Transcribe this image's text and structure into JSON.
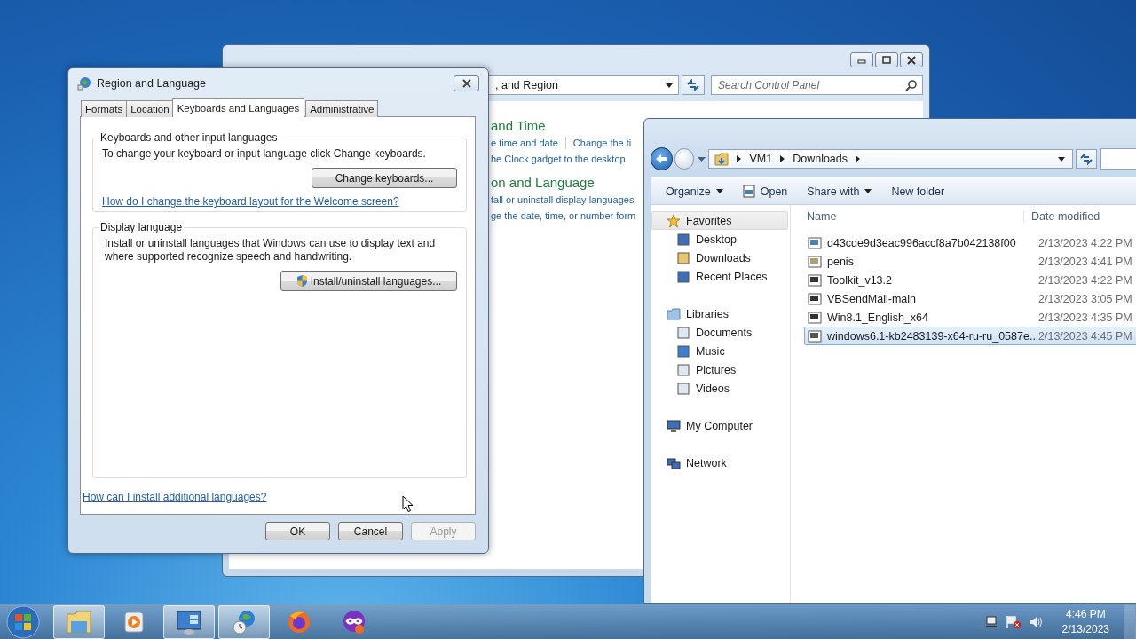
{
  "control_panel": {
    "address": ", and Region",
    "search_placeholder": "Search Control Panel",
    "sections": [
      {
        "heading": "and Time",
        "link_rows": [
          [
            "e time and date",
            "Change the ti"
          ],
          [
            "he Clock gadget to the desktop"
          ]
        ]
      },
      {
        "heading": "on and Language",
        "link_rows": [
          [
            "tall or uninstall display languages"
          ],
          [
            "ge the date, time, or number form"
          ]
        ]
      }
    ]
  },
  "region_dialog": {
    "title": "Region and Language",
    "tabs": [
      {
        "label": "Formats",
        "selected": false
      },
      {
        "label": "Location",
        "selected": false
      },
      {
        "label": "Keyboards and Languages",
        "selected": true
      },
      {
        "label": "Administrative",
        "selected": false
      }
    ],
    "groups": [
      {
        "legend": "Keyboards and other input languages",
        "text": "To change your keyboard or input language click Change keyboards.",
        "button": {
          "label": "Change keyboards...",
          "shield": false
        },
        "link": "How do I change the keyboard layout for the Welcome screen?"
      },
      {
        "legend": "Display language",
        "text": "Install or uninstall languages that Windows can use to display text and where supported recognize speech and handwriting.",
        "button": {
          "label": "Install/uninstall languages...",
          "shield": true
        }
      }
    ],
    "footer_link": "How can I install additional languages?",
    "buttons": [
      {
        "label": "OK",
        "disabled": false
      },
      {
        "label": "Cancel",
        "disabled": false
      },
      {
        "label": "Apply",
        "disabled": true
      }
    ]
  },
  "explorer": {
    "breadcrumb": [
      "VM1",
      "Downloads"
    ],
    "toolbar": [
      {
        "label": "Organize",
        "kind": "menu"
      },
      {
        "label": "Open",
        "kind": "icon"
      },
      {
        "label": "Share with",
        "kind": "menu"
      },
      {
        "label": "New folder",
        "kind": "plain"
      }
    ],
    "nav": [
      {
        "label": "Favorites",
        "selected": true,
        "children": [
          {
            "label": "Desktop",
            "selected": false
          },
          {
            "label": "Downloads",
            "selected": false
          },
          {
            "label": "Recent Places",
            "selected": false
          }
        ]
      },
      {
        "label": "Libraries",
        "selected": false,
        "children": [
          {
            "label": "Documents",
            "selected": false
          },
          {
            "label": "Music",
            "selected": false
          },
          {
            "label": "Pictures",
            "selected": false
          },
          {
            "label": "Videos",
            "selected": false
          }
        ]
      },
      {
        "label": "My Computer",
        "selected": false
      },
      {
        "label": "Network",
        "selected": false
      }
    ],
    "columns": [
      "Name",
      "Date modified"
    ],
    "files": [
      {
        "name": "d43cde9d3eac996accf8a7b042138f00",
        "date": "2/13/2023 4:22 PM",
        "selected": false
      },
      {
        "name": "penis",
        "date": "2/13/2023 4:41 PM",
        "selected": false
      },
      {
        "name": "Toolkit_v13.2",
        "date": "2/13/2023 4:22 PM",
        "selected": false
      },
      {
        "name": "VBSendMail-main",
        "date": "2/13/2023 3:05 PM",
        "selected": false
      },
      {
        "name": "Win8.1_English_x64",
        "date": "2/13/2023 4:35 PM",
        "selected": false
      },
      {
        "name": "windows6.1-kb2483139-x64-ru-ru_0587e...",
        "date": "2/13/2023 4:45 PM",
        "selected": true
      }
    ]
  },
  "taskbar": {
    "apps": [
      {
        "active": true
      },
      {
        "active": false
      },
      {
        "active": true
      },
      {
        "active": true
      },
      {
        "active": false
      },
      {
        "active": false
      }
    ],
    "clock": {
      "time": "4:46 PM",
      "date": "2/13/2023"
    }
  }
}
